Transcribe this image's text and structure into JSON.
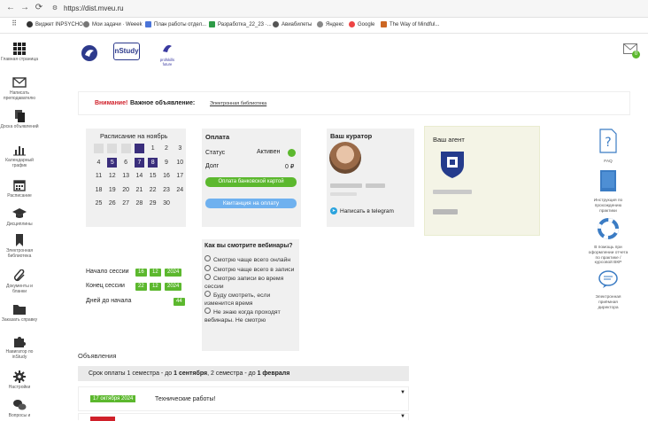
{
  "browser": {
    "url": "https://dist.mveu.ru",
    "bookmarks": [
      "Виджет INPSYCHO",
      "Мои задачи · Weeek",
      "План работы отдел...",
      "Разработка_22_23 ·...",
      "Авиабилеты",
      "Яндекс",
      "Google",
      "The Way of Mindful..."
    ]
  },
  "sidebar": {
    "items": [
      {
        "label": "Главная страница",
        "icon": "grid-icon"
      },
      {
        "label": "Написать преподавателю",
        "icon": "envelope-icon"
      },
      {
        "label": "Доска объявлений",
        "icon": "documents-icon"
      },
      {
        "label": "Календарный график",
        "icon": "chart-icon"
      },
      {
        "label": "Расписание",
        "icon": "calendar-icon"
      },
      {
        "label": "Дисциплины",
        "icon": "graduation-cap-icon"
      },
      {
        "label": "Электронная библиотека",
        "icon": "bookmark-icon"
      },
      {
        "label": "Документы и бланки",
        "icon": "paperclip-icon"
      },
      {
        "label": "Заказать справку",
        "icon": "folder-icon"
      },
      {
        "label": "Навигатор по inStudy",
        "icon": "puzzle-icon"
      },
      {
        "label": "Настройки",
        "icon": "gear-icon"
      },
      {
        "label": "Вопросы и",
        "icon": "chat-icon"
      }
    ]
  },
  "header": {
    "logo2_text": "nStudy",
    "logo3_text": "profskills future",
    "mail_badge": "0"
  },
  "announcement": {
    "attention": "Внимание!",
    "important": "Важное объявление:",
    "link": "Электронная библиотека"
  },
  "schedule": {
    "title": "Расписание на ноябрь",
    "rows": [
      [
        {
          "d": "",
          "s": "none"
        },
        {
          "d": "",
          "s": "bg"
        },
        {
          "d": "",
          "s": "bg"
        },
        {
          "d": "",
          "s": "bg"
        },
        {
          "d": "",
          "s": "hl"
        },
        {
          "d": "1",
          "s": "none"
        },
        {
          "d": "2",
          "s": "none"
        },
        {
          "d": "3",
          "s": "none"
        }
      ],
      [
        {
          "d": "4",
          "s": "none"
        },
        {
          "d": "5",
          "s": "hl"
        },
        {
          "d": "6",
          "s": "none"
        },
        {
          "d": "7",
          "s": "hl"
        },
        {
          "d": "8",
          "s": "hl"
        },
        {
          "d": "9",
          "s": "none"
        },
        {
          "d": "10",
          "s": "none"
        }
      ],
      [
        {
          "d": "11",
          "s": "none"
        },
        {
          "d": "12",
          "s": "none"
        },
        {
          "d": "13",
          "s": "none"
        },
        {
          "d": "14",
          "s": "none"
        },
        {
          "d": "15",
          "s": "none"
        },
        {
          "d": "16",
          "s": "none"
        },
        {
          "d": "17",
          "s": "none"
        }
      ],
      [
        {
          "d": "18",
          "s": "none"
        },
        {
          "d": "19",
          "s": "none"
        },
        {
          "d": "20",
          "s": "none"
        },
        {
          "d": "21",
          "s": "none"
        },
        {
          "d": "22",
          "s": "none"
        },
        {
          "d": "23",
          "s": "none"
        },
        {
          "d": "24",
          "s": "none"
        }
      ],
      [
        {
          "d": "25",
          "s": "none"
        },
        {
          "d": "26",
          "s": "none"
        },
        {
          "d": "27",
          "s": "none"
        },
        {
          "d": "28",
          "s": "none"
        },
        {
          "d": "29",
          "s": "none"
        },
        {
          "d": "30",
          "s": "none"
        }
      ]
    ]
  },
  "payment": {
    "title": "Оплата",
    "status_label": "Статус",
    "status_value": "Активен",
    "debt_label": "Долг",
    "debt_value": "0 ₽",
    "btn_card": "Оплата банковской картой",
    "btn_receipt": "Квитанция на оплату"
  },
  "curator": {
    "title": "Ваш куратор",
    "telegram": "Написать в telegram"
  },
  "agent": {
    "title": "Ваш агент"
  },
  "session": {
    "start_label": "Начало сессии",
    "start": [
      "16",
      "12",
      "2024"
    ],
    "end_label": "Конец сессии",
    "end": [
      "22",
      "12",
      "2024"
    ],
    "days_label": "Дней до начала",
    "days": "44"
  },
  "poll": {
    "title": "Как вы смотрите вебинары?",
    "options": [
      "Смотрю чаще всего онлайн",
      "Смотрю чаще всего в записи",
      "Смотрю записи во время сессии",
      "Буду смотреть, если изменится время",
      "Не знаю когда проходят вебинары. Не смотрю"
    ]
  },
  "right_panel": [
    {
      "label": "FAQ",
      "icon": "question-doc-icon"
    },
    {
      "label": "Инструкция по прохождению практики",
      "icon": "book-icon"
    },
    {
      "label": "В помощь при оформлении отчета по практике / курсовой ВКР",
      "icon": "lifebuoy-icon"
    },
    {
      "label": "Электронная приёмная директора",
      "icon": "speech-icon"
    }
  ],
  "announcements": {
    "title": "Объявления",
    "payment_prefix": "Срок оплаты 1 семестра - до ",
    "payment_date1": "1 сентября",
    "payment_mid": ", 2 семестра - до ",
    "payment_date2": "1 февраля",
    "item_date": "17 октября 2024",
    "item_title": "Технические работы!"
  },
  "colors": {
    "accent_dark": "#3a2e7c",
    "green": "#5cb82e",
    "blue_button": "#6fb1ef",
    "red": "#d0202a"
  }
}
